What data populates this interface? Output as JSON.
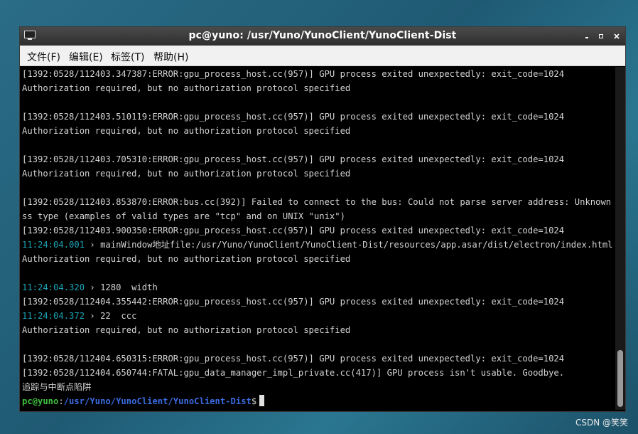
{
  "window": {
    "title": "pc@yuno: /usr/Yuno/YunoClient/YunoClient-Dist",
    "minimize": "▪",
    "maximize": "▫",
    "close": "×"
  },
  "menubar": {
    "items": [
      {
        "label": "文件(F)"
      },
      {
        "label": "编辑(E)"
      },
      {
        "label": "标签(T)"
      },
      {
        "label": "帮助(H)"
      }
    ]
  },
  "terminal": {
    "lines": [
      {
        "text": "[1392:0528/112403.347387:ERROR:gpu_process_host.cc(957)] GPU process exited unexpectedly: exit_code=1024"
      },
      {
        "text": "Authorization required, but no authorization protocol specified"
      },
      {
        "text": ""
      },
      {
        "text": "[1392:0528/112403.510119:ERROR:gpu_process_host.cc(957)] GPU process exited unexpectedly: exit_code=1024"
      },
      {
        "text": "Authorization required, but no authorization protocol specified"
      },
      {
        "text": ""
      },
      {
        "text": "[1392:0528/112403.705310:ERROR:gpu_process_host.cc(957)] GPU process exited unexpectedly: exit_code=1024"
      },
      {
        "text": "Authorization required, but no authorization protocol specified"
      },
      {
        "text": ""
      },
      {
        "text": "[1392:0528/112403.853870:ERROR:bus.cc(392)] Failed to connect to the bus: Could not parse server address: Unknown addre"
      },
      {
        "text": "ss type (examples of valid types are \"tcp\" and on UNIX \"unix\")"
      },
      {
        "text": "[1392:0528/112403.900350:ERROR:gpu_process_host.cc(957)] GPU process exited unexpectedly: exit_code=1024"
      },
      {
        "ts": "11:24:04.001",
        "text": " › mainWindow地址file:/usr/Yuno/YunoClient/YunoClient-Dist/resources/app.asar/dist/electron/index.html"
      },
      {
        "text": "Authorization required, but no authorization protocol specified"
      },
      {
        "text": ""
      },
      {
        "ts": "11:24:04.320",
        "text": " › 1280  width"
      },
      {
        "text": "[1392:0528/112404.355442:ERROR:gpu_process_host.cc(957)] GPU process exited unexpectedly: exit_code=1024"
      },
      {
        "ts": "11:24:04.372",
        "text": " › 22  ccc"
      },
      {
        "text": "Authorization required, but no authorization protocol specified"
      },
      {
        "text": ""
      },
      {
        "text": "[1392:0528/112404.650315:ERROR:gpu_process_host.cc(957)] GPU process exited unexpectedly: exit_code=1024"
      },
      {
        "text": "[1392:0528/112404.650744:FATAL:gpu_data_manager_impl_private.cc(417)] GPU process isn't usable. Goodbye."
      },
      {
        "text": "追踪与中断点陷阱"
      }
    ],
    "prompt": {
      "user": "pc@yuno",
      "sep": ":",
      "path": "/usr/Yuno/YunoClient/YunoClient-Dist",
      "symbol": "$"
    }
  },
  "watermark": "CSDN @笑笑"
}
